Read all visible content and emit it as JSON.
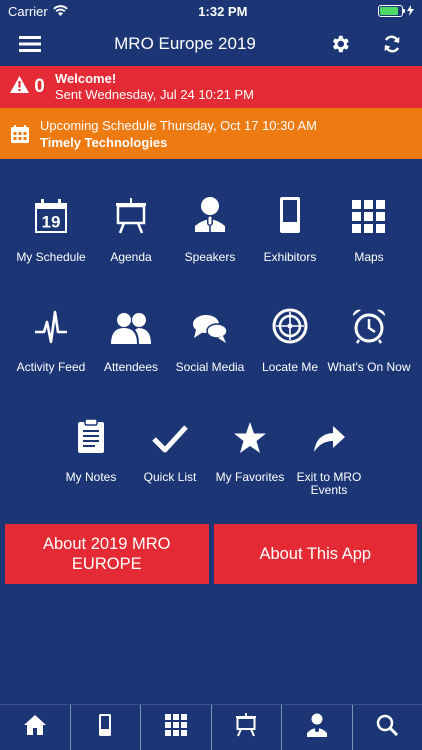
{
  "status": {
    "carrier": "Carrier",
    "time": "1:32 PM",
    "battery_level": 0.85
  },
  "nav": {
    "title": "MRO Europe 2019"
  },
  "alert": {
    "count": "0",
    "title": "Welcome!",
    "subtitle": "Sent Wednesday, Jul 24 10:21 PM"
  },
  "upcoming": {
    "line1": "Upcoming Schedule Thursday, Oct 17 10:30 AM",
    "line2": "Timely Technologies"
  },
  "menu": [
    {
      "label": "My Schedule",
      "icon": "calendar-icon"
    },
    {
      "label": "Agenda",
      "icon": "easel-icon"
    },
    {
      "label": "Speakers",
      "icon": "speaker-icon"
    },
    {
      "label": "Exhibitors",
      "icon": "booth-icon"
    },
    {
      "label": "Maps",
      "icon": "map-grid-icon"
    },
    {
      "label": "Activity Feed",
      "icon": "pulse-icon"
    },
    {
      "label": "Attendees",
      "icon": "people-icon"
    },
    {
      "label": "Social Media",
      "icon": "chat-bubbles-icon"
    },
    {
      "label": "Locate Me",
      "icon": "target-icon"
    },
    {
      "label": "What's On Now",
      "icon": "alarm-clock-icon"
    },
    {
      "label": "My Notes",
      "icon": "clipboard-icon"
    },
    {
      "label": "Quick List",
      "icon": "checkmark-icon"
    },
    {
      "label": "My Favorites",
      "icon": "star-icon"
    },
    {
      "label": "Exit to MRO Events",
      "icon": "share-arrow-icon"
    }
  ],
  "calendar_day": "19",
  "buttons": {
    "about_event": "About 2019 MRO EUROPE",
    "about_app": "About This App"
  },
  "tabs": [
    "home-icon",
    "booth-icon",
    "map-grid-icon",
    "easel-icon",
    "speaker-icon",
    "search-icon"
  ],
  "colors": {
    "background": "#1b3575",
    "alert_red": "#e32a35",
    "alert_orange": "#ee7a12"
  }
}
